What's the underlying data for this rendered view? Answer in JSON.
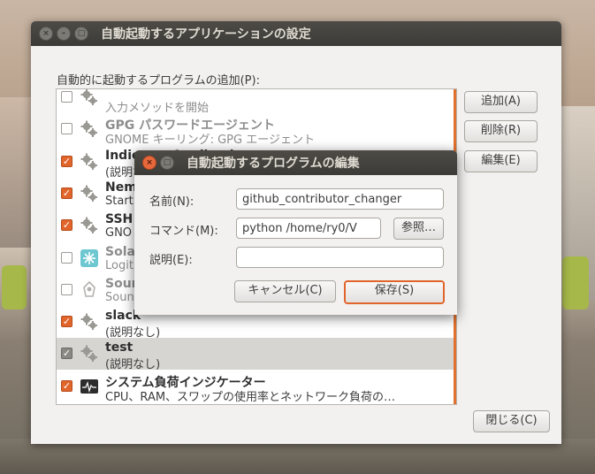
{
  "main_window": {
    "title": "自動起動するアプリケーションの設定",
    "section_label": "自動的に起動するプログラムの追加(P):",
    "buttons": {
      "add": "追加(A)",
      "remove": "削除(R)",
      "edit": "編集(E)",
      "close": "閉じる(C)"
    },
    "programs": [
      {
        "title": "",
        "desc": "入力メソッドを開始",
        "checked": false,
        "dim": true,
        "partial": true
      },
      {
        "title": "GPG パスワードエージェント",
        "desc": "GNOME キーリング: GPG エージェント",
        "checked": false,
        "dim": true
      },
      {
        "title": "Indicator Application",
        "desc": "(説明なし)",
        "checked": true
      },
      {
        "title": "Nem",
        "desc": "Start",
        "checked": true
      },
      {
        "title": "SSH",
        "desc": "GNO",
        "checked": true
      },
      {
        "title": "Sola",
        "desc": "Logit",
        "checked": false,
        "dim": true
      },
      {
        "title": "Soun",
        "desc": "Soun",
        "checked": false,
        "dim": true
      },
      {
        "title": "slack",
        "desc": "(説明なし)",
        "checked": true
      },
      {
        "title": "test",
        "desc": "(説明なし)",
        "checked": true,
        "selected": true
      },
      {
        "title": "システム負荷インジケーター",
        "desc": "CPU、RAM、スワップの使用率とネットワーク負荷の…",
        "checked": true
      }
    ]
  },
  "edit_dialog": {
    "title": "自動起動するプログラムの編集",
    "name_label": "名前(N):",
    "name_value": "github_contributor_changer",
    "command_label": "コマンド(M):",
    "command_value": "python /home/ry0/V",
    "browse_label": "参照…",
    "desc_label": "説明(E):",
    "desc_value": "",
    "cancel_label": "キャンセル(C)",
    "save_label": "保存(S)"
  },
  "colors": {
    "accent": "#e1652b",
    "titlebar": "#3c3b37",
    "window_bg": "#f2f1f0"
  }
}
